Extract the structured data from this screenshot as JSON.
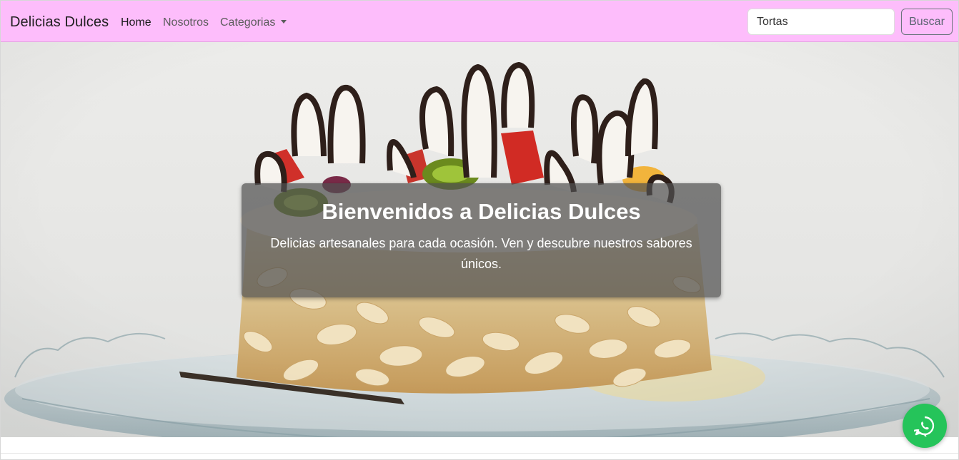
{
  "navbar": {
    "brand": "Delicias Dulces",
    "links": [
      {
        "label": "Home",
        "active": true
      },
      {
        "label": "Nosotros",
        "active": false
      },
      {
        "label": "Categorias",
        "active": false,
        "dropdown": true
      }
    ],
    "search": {
      "value": "Tortas",
      "placeholder": "Tortas"
    },
    "search_button": "Buscar",
    "background_color": "#fdbdfb"
  },
  "hero": {
    "title": "Bienvenidos a Delicias Dulces",
    "subtitle": "Delicias artesanales para cada ocasión. Ven y descubre nuestros sabores únicos.",
    "image_subject": "cake with chocolate decorations, strawberries, kiwi and sliced almonds on glass plate"
  },
  "floating": {
    "whatsapp_icon": "whatsapp-icon",
    "color": "#25c45a"
  }
}
